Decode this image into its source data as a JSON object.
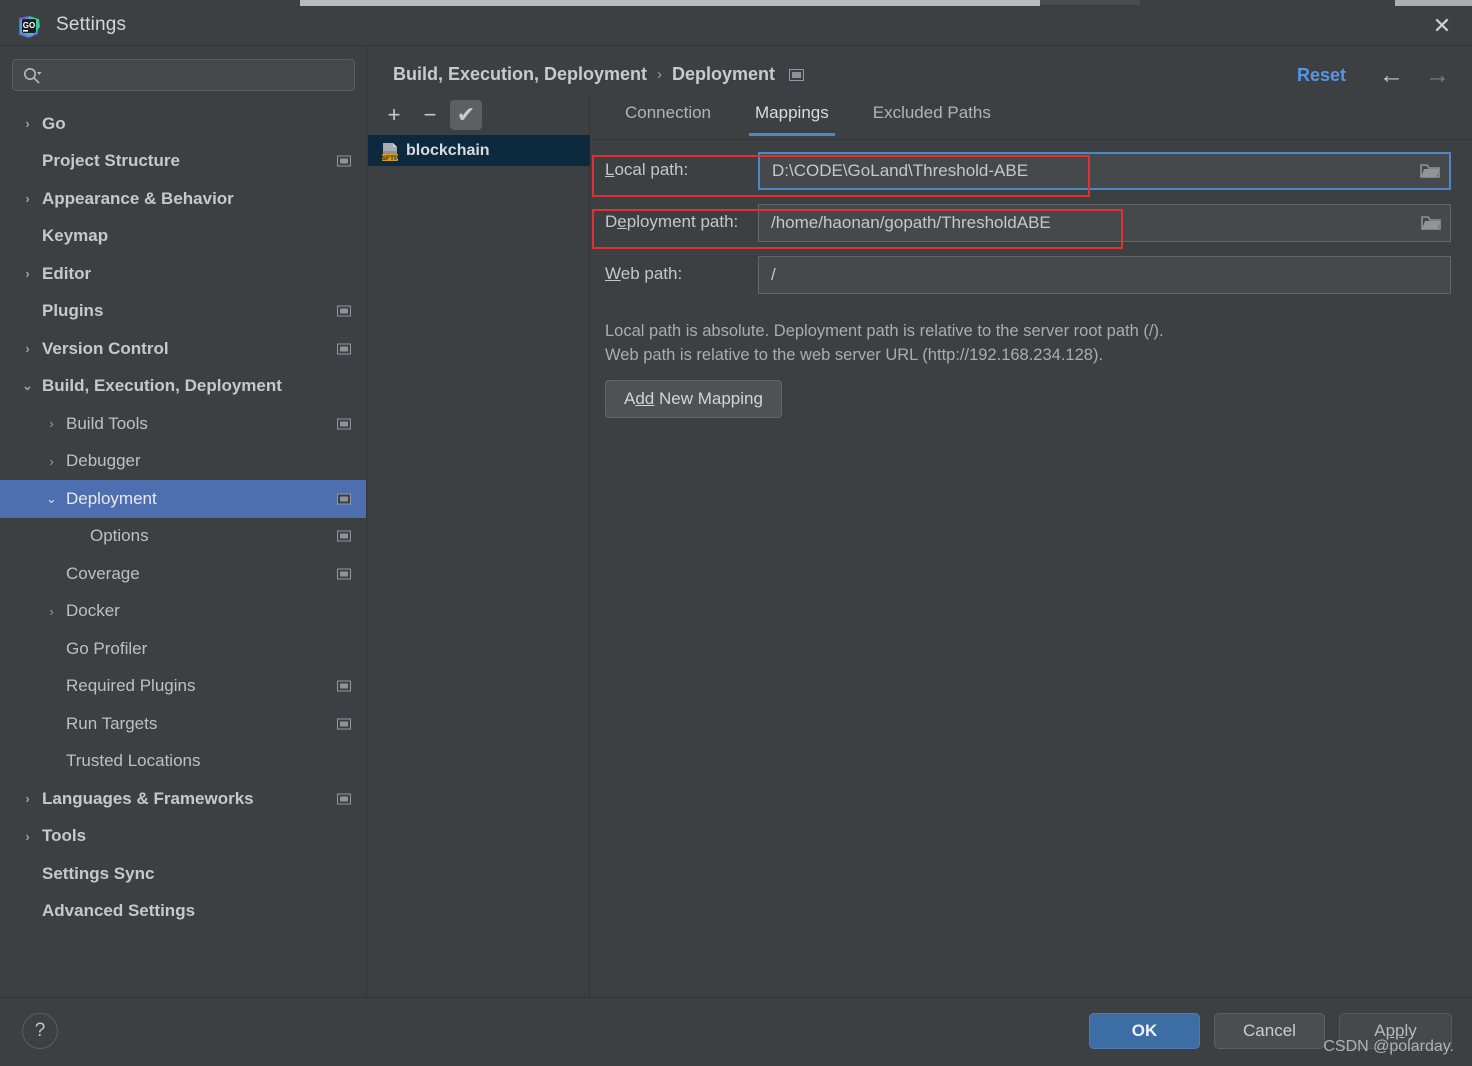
{
  "window": {
    "title": "Settings",
    "close_label": "✕",
    "app_icon": "goland-logo-icon"
  },
  "search": {
    "value": "",
    "placeholder": ""
  },
  "sidebar": {
    "items": [
      {
        "label": "Go",
        "arrow": "›",
        "indent": 0,
        "bold": true,
        "badge": false,
        "selected": false
      },
      {
        "label": "Project Structure",
        "arrow": "",
        "indent": 0,
        "bold": true,
        "badge": true,
        "selected": false
      },
      {
        "label": "Appearance & Behavior",
        "arrow": "›",
        "indent": 0,
        "bold": true,
        "badge": false,
        "selected": false
      },
      {
        "label": "Keymap",
        "arrow": "",
        "indent": 0,
        "bold": true,
        "badge": false,
        "selected": false
      },
      {
        "label": "Editor",
        "arrow": "›",
        "indent": 0,
        "bold": true,
        "badge": false,
        "selected": false
      },
      {
        "label": "Plugins",
        "arrow": "",
        "indent": 0,
        "bold": true,
        "badge": true,
        "selected": false
      },
      {
        "label": "Version Control",
        "arrow": "›",
        "indent": 0,
        "bold": true,
        "badge": true,
        "selected": false
      },
      {
        "label": "Build, Execution, Deployment",
        "arrow": "⌄",
        "indent": 0,
        "bold": true,
        "badge": false,
        "selected": false
      },
      {
        "label": "Build Tools",
        "arrow": "›",
        "indent": 1,
        "bold": false,
        "badge": true,
        "selected": false
      },
      {
        "label": "Debugger",
        "arrow": "›",
        "indent": 1,
        "bold": false,
        "badge": false,
        "selected": false
      },
      {
        "label": "Deployment",
        "arrow": "⌄",
        "indent": 1,
        "bold": false,
        "badge": true,
        "selected": true
      },
      {
        "label": "Options",
        "arrow": "",
        "indent": 2,
        "bold": false,
        "badge": true,
        "selected": false
      },
      {
        "label": "Coverage",
        "arrow": "",
        "indent": 1,
        "bold": false,
        "badge": true,
        "selected": false
      },
      {
        "label": "Docker",
        "arrow": "›",
        "indent": 1,
        "bold": false,
        "badge": false,
        "selected": false
      },
      {
        "label": "Go Profiler",
        "arrow": "",
        "indent": 1,
        "bold": false,
        "badge": false,
        "selected": false
      },
      {
        "label": "Required Plugins",
        "arrow": "",
        "indent": 1,
        "bold": false,
        "badge": true,
        "selected": false
      },
      {
        "label": "Run Targets",
        "arrow": "",
        "indent": 1,
        "bold": false,
        "badge": true,
        "selected": false
      },
      {
        "label": "Trusted Locations",
        "arrow": "",
        "indent": 1,
        "bold": false,
        "badge": false,
        "selected": false
      },
      {
        "label": "Languages & Frameworks",
        "arrow": "›",
        "indent": 0,
        "bold": true,
        "badge": true,
        "selected": false
      },
      {
        "label": "Tools",
        "arrow": "›",
        "indent": 0,
        "bold": true,
        "badge": false,
        "selected": false
      },
      {
        "label": "Settings Sync",
        "arrow": "",
        "indent": 0,
        "bold": true,
        "badge": false,
        "selected": false
      },
      {
        "label": "Advanced Settings",
        "arrow": "",
        "indent": 0,
        "bold": true,
        "badge": false,
        "selected": false
      }
    ]
  },
  "header": {
    "breadcrumb_parent": "Build, Execution, Deployment",
    "breadcrumb_sep": "›",
    "breadcrumb_current": "Deployment",
    "reset_label": "Reset",
    "back_arrow": "←",
    "forward_arrow": "→"
  },
  "servers": {
    "toolbar": {
      "add_label": "+",
      "remove_label": "−",
      "default_label": "✔"
    },
    "items": [
      {
        "name": "blockchain",
        "icon": "sftp-server-icon",
        "badge_text": "SFTP",
        "selected": true
      }
    ]
  },
  "tabs": [
    {
      "label": "Connection",
      "active": false
    },
    {
      "label": "Mappings",
      "active": true
    },
    {
      "label": "Excluded Paths",
      "active": false
    }
  ],
  "mappings": {
    "local_path": {
      "label_pre": "L",
      "label_post": "ocal path:",
      "value": "D:\\CODE\\GoLand\\Threshold-ABE",
      "focused": true
    },
    "deployment_path": {
      "label_pre": "D",
      "label_mid": "e",
      "label_post": "ployment path:",
      "value": "/home/haonan/gopath/ThresholdABE",
      "focused": false
    },
    "web_path": {
      "label_pre": "W",
      "label_post": "eb path:",
      "value": "/",
      "focused": false
    },
    "hint_line1": "Local path is absolute. Deployment path is relative to the server root path (/).",
    "hint_line2": "Web path is relative to the web server URL (http://192.168.234.128).",
    "add_mapping_pre": "A",
    "add_mapping_mid": "dd",
    "add_mapping_post": " New Mapping"
  },
  "footer": {
    "help_label": "?",
    "ok_label": "OK",
    "cancel_label": "Cancel",
    "apply_pre": "A",
    "apply_mid": "pp",
    "apply_post": "ly",
    "watermark": "CSDN @polarday."
  },
  "colors": {
    "accent_blue": "#4a88c7",
    "selection_blue": "#4d6eaf",
    "link_blue": "#5596e6",
    "annotation_red": "#e03131",
    "server_selected": "#0d293e",
    "panel_bg": "#3c4043"
  }
}
